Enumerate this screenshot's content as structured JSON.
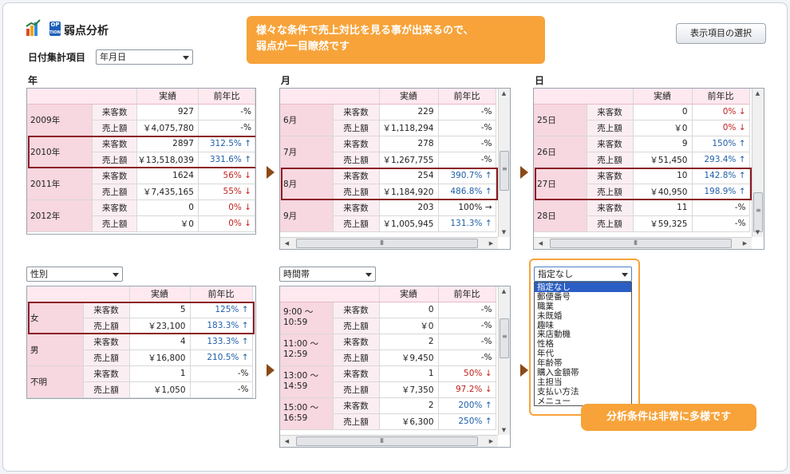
{
  "header": {
    "logo_badge_top": "OP",
    "logo_badge_bottom": "TION",
    "title": "弱点分析",
    "display_button": "表示項目の選択",
    "date_label": "日付集計項目",
    "date_select": "年月日"
  },
  "callout_main": {
    "line1": "様々な条件で売上対比を見る事が出来るので、",
    "line2": "弱点が一目瞭然です"
  },
  "callout_options": "分析条件は非常に多様です",
  "columns": {
    "actual": "実績",
    "yoy": "前年比"
  },
  "metrics": {
    "visitors": "来客数",
    "sales": "売上額"
  },
  "year": {
    "label": "年",
    "rows": [
      {
        "group": "2009年",
        "visitors": "927",
        "visitors_yoy": "-%",
        "sales": "￥4,075,780",
        "sales_yoy": "-%"
      },
      {
        "group": "2010年",
        "visitors": "2897",
        "visitors_yoy": "312.5% ↑",
        "sales": "￥13,518,039",
        "sales_yoy": "331.6% ↑"
      },
      {
        "group": "2011年",
        "visitors": "1624",
        "visitors_yoy": "56% ↓",
        "sales": "￥7,435,165",
        "sales_yoy": "55% ↓"
      },
      {
        "group": "2012年",
        "visitors": "0",
        "visitors_yoy": "0% ↓",
        "sales": "￥0",
        "sales_yoy": "0% ↓"
      }
    ]
  },
  "month": {
    "label": "月",
    "rows": [
      {
        "group": "6月",
        "visitors": "229",
        "visitors_yoy": "-%",
        "sales": "￥1,118,294",
        "sales_yoy": "-%"
      },
      {
        "group": "7月",
        "visitors": "278",
        "visitors_yoy": "-%",
        "sales": "￥1,267,755",
        "sales_yoy": "-%"
      },
      {
        "group": "8月",
        "visitors": "254",
        "visitors_yoy": "390.7% ↑",
        "sales": "￥1,184,920",
        "sales_yoy": "486.8% ↑"
      },
      {
        "group": "9月",
        "visitors": "203",
        "visitors_yoy": "100% →",
        "sales": "￥1,005,945",
        "sales_yoy": "131.3% ↑"
      }
    ]
  },
  "day": {
    "label": "日",
    "rows": [
      {
        "group": "25日",
        "visitors": "0",
        "visitors_yoy": "0% ↓",
        "sales": "￥0",
        "sales_yoy": "0% ↓"
      },
      {
        "group": "26日",
        "visitors": "9",
        "visitors_yoy": "150% ↑",
        "sales": "￥51,450",
        "sales_yoy": "293.4% ↑"
      },
      {
        "group": "27日",
        "visitors": "10",
        "visitors_yoy": "142.8% ↑",
        "sales": "￥40,950",
        "sales_yoy": "198.9% ↑"
      },
      {
        "group": "28日",
        "visitors": "11",
        "visitors_yoy": "-%",
        "sales": "￥59,325",
        "sales_yoy": "-%"
      }
    ]
  },
  "gender": {
    "select": "性別",
    "rows": [
      {
        "group": "女",
        "visitors": "5",
        "visitors_yoy": "125% ↑",
        "sales": "￥23,100",
        "sales_yoy": "183.3% ↑"
      },
      {
        "group": "男",
        "visitors": "4",
        "visitors_yoy": "133.3% ↑",
        "sales": "￥16,800",
        "sales_yoy": "210.5% ↑"
      },
      {
        "group": "不明",
        "visitors": "1",
        "visitors_yoy": "-%",
        "sales": "￥1,050",
        "sales_yoy": "-%"
      }
    ]
  },
  "timeslot": {
    "select": "時間帯",
    "rows": [
      {
        "group": "9:00 ～ 10:59",
        "visitors": "0",
        "visitors_yoy": "-%",
        "sales": "￥0",
        "sales_yoy": "-%"
      },
      {
        "group": "11:00 ～ 12:59",
        "visitors": "2",
        "visitors_yoy": "-%",
        "sales": "￥9,450",
        "sales_yoy": "-%"
      },
      {
        "group": "13:00 ～ 14:59",
        "visitors": "1",
        "visitors_yoy": "50% ↓",
        "sales": "￥7,350",
        "sales_yoy": "97.2% ↓"
      },
      {
        "group": "15:00 ～ 16:59",
        "visitors": "2",
        "visitors_yoy": "200% ↑",
        "sales": "￥6,300",
        "sales_yoy": "250% ↑"
      }
    ]
  },
  "options": {
    "selected": "指定なし",
    "items": [
      "指定なし",
      "郵便番号",
      "職業",
      "未既婚",
      "趣味",
      "来店動機",
      "性格",
      "年代",
      "年齢帯",
      "購入金額帯",
      "主担当",
      "支払い方法",
      "メニュー"
    ]
  },
  "colors": {
    "accent": "#f7a33a",
    "highlight": "#8b1d25",
    "up": "#1f5ea8",
    "down": "#c0221f",
    "header_pink": "#fde9ef"
  }
}
